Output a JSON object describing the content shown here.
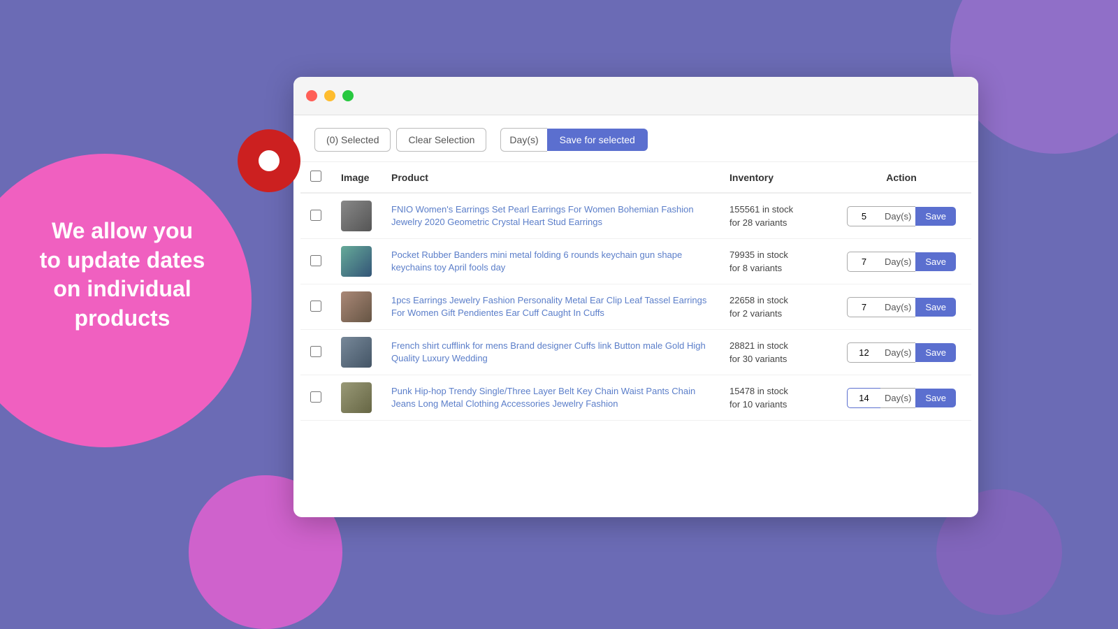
{
  "background": {
    "color": "#6b6bb5"
  },
  "left_text": {
    "line1": "We allow you",
    "line2": "to update dates",
    "line3": "on individual",
    "line4": "products"
  },
  "toolbar": {
    "selected_label": "(0) Selected",
    "clear_label": "Clear Selection",
    "days_label": "Day(s)",
    "save_selected_label": "Save for selected"
  },
  "table": {
    "headers": {
      "image": "Image",
      "product": "Product",
      "inventory": "Inventory",
      "action": "Action"
    },
    "rows": [
      {
        "id": 1,
        "product_name": "FNIO Women's Earrings Set Pearl Earrings For Women Bohemian Fashion Jewelry 2020 Geometric Crystal Heart Stud Earrings",
        "inventory": "155561 in stock",
        "variants": "for 28 variants",
        "days_value": "5",
        "thumb_class": "thumb-p1"
      },
      {
        "id": 2,
        "product_name": "Pocket Rubber Banders mini metal folding 6 rounds keychain gun shape keychains toy April fools day",
        "inventory": "79935 in stock",
        "variants": "for 8 variants",
        "days_value": "7",
        "thumb_class": "thumb-p2"
      },
      {
        "id": 3,
        "product_name": "1pcs Earrings Jewelry Fashion Personality Metal Ear Clip Leaf Tassel Earrings For Women Gift Pendientes Ear Cuff Caught In Cuffs",
        "inventory": "22658 in stock",
        "variants": "for 2 variants",
        "days_value": "7",
        "thumb_class": "thumb-p3"
      },
      {
        "id": 4,
        "product_name": "French shirt cufflink for mens Brand designer Cuffs link Button male Gold High Quality Luxury Wedding",
        "inventory": "28821 in stock",
        "variants": "for 30 variants",
        "days_value": "12",
        "thumb_class": "thumb-p4"
      },
      {
        "id": 5,
        "product_name": "Punk Hip-hop Trendy Single/Three Layer Belt Key Chain Waist Pants Chain Jeans Long Metal Clothing Accessories Jewelry Fashion",
        "inventory": "15478 in stock",
        "variants": "for 10 variants",
        "days_value": "14",
        "thumb_class": "thumb-p5",
        "active": true
      }
    ]
  }
}
